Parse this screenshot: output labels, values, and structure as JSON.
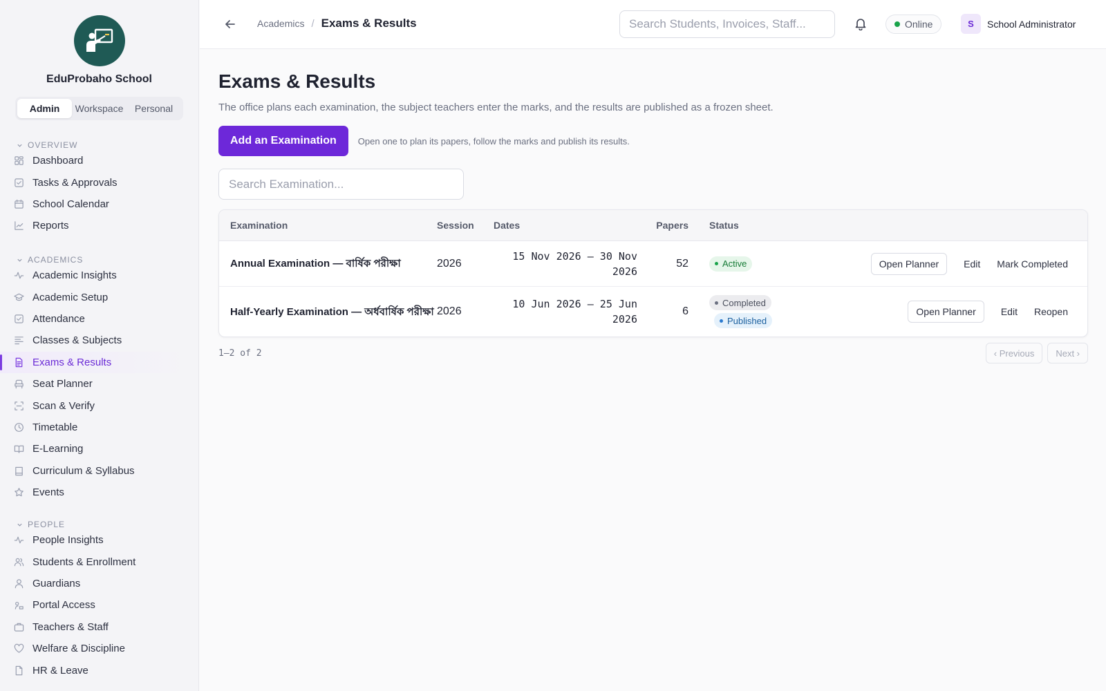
{
  "sidebar": {
    "school_name": "EduProbaho School",
    "modes": [
      "Admin",
      "Workspace",
      "Personal"
    ],
    "sections": [
      {
        "label": "OVERVIEW",
        "items": [
          "Dashboard",
          "Tasks & Approvals",
          "School Calendar",
          "Reports"
        ]
      },
      {
        "label": "ACADEMICS",
        "items": [
          "Academic Insights",
          "Academic Setup",
          "Attendance",
          "Classes & Subjects",
          "Exams & Results",
          "Seat Planner",
          "Scan & Verify",
          "Timetable",
          "E-Learning",
          "Curriculum & Syllabus",
          "Events"
        ]
      },
      {
        "label": "PEOPLE",
        "items": [
          "People Insights",
          "Students & Enrollment",
          "Guardians",
          "Portal Access",
          "Teachers & Staff",
          "Welfare & Discipline",
          "HR & Leave"
        ]
      }
    ]
  },
  "header": {
    "breadcrumb_parent": "Academics",
    "breadcrumb_separator": "/",
    "breadcrumb_current": "Exams & Results",
    "search_placeholder": "Search Students, Invoices, Staff...",
    "status": "Online",
    "user_initial": "S",
    "user_name": "School Administrator"
  },
  "main": {
    "title": "Exams & Results",
    "description": "The office plans each examination, the subject teachers enter the marks, and the results are published as a frozen sheet.",
    "add_button": "Add an Examination",
    "add_hint": "Open one to plan its papers, follow the marks and publish its results.",
    "search_placeholder": "Search Examination...",
    "columns": {
      "exam": "Examination",
      "session": "Session",
      "dates": "Dates",
      "papers": "Papers",
      "status": "Status"
    },
    "rows": [
      {
        "exam": "Annual Examination — বার্ষিক পরীক্ষা",
        "session": "2026",
        "dates": "15 Nov 2026 – 30 Nov 2026",
        "papers": "52",
        "status": "Active",
        "actions": [
          "Open Planner",
          "Edit",
          "Mark Completed"
        ]
      },
      {
        "exam": "Half-Yearly Examination — অর্ধবার্ষিক পরীক্ষা",
        "session": "2026",
        "dates": "10 Jun 2026 – 25 Jun 2026",
        "papers": "6",
        "status": "Completed",
        "status2": "Published",
        "actions": [
          "Open Planner",
          "Edit",
          "Reopen"
        ]
      }
    ],
    "count": "1–2 of 2",
    "prev": "‹ Previous",
    "next": "Next ›"
  },
  "colors": {
    "accent": "#6d28d9",
    "logo_bg": "#1f5a55",
    "active_green": "#19a34a",
    "published_blue": "#2a7ad0"
  },
  "icons": {
    "OVERVIEW": [
      "dashboard-icon",
      "checkbox-icon",
      "calendar-icon",
      "chart-icon"
    ],
    "ACADEMICS": [
      "activity-icon",
      "graduation-cap-icon",
      "checkbox-icon",
      "list-icon",
      "document-icon",
      "seat-icon",
      "scan-icon",
      "clock-icon",
      "open-book-icon",
      "book-icon",
      "star-icon"
    ],
    "PEOPLE": [
      "activity-icon",
      "users-icon",
      "user-icon",
      "key-icon",
      "briefcase-icon",
      "heart-icon",
      "file-icon"
    ]
  }
}
